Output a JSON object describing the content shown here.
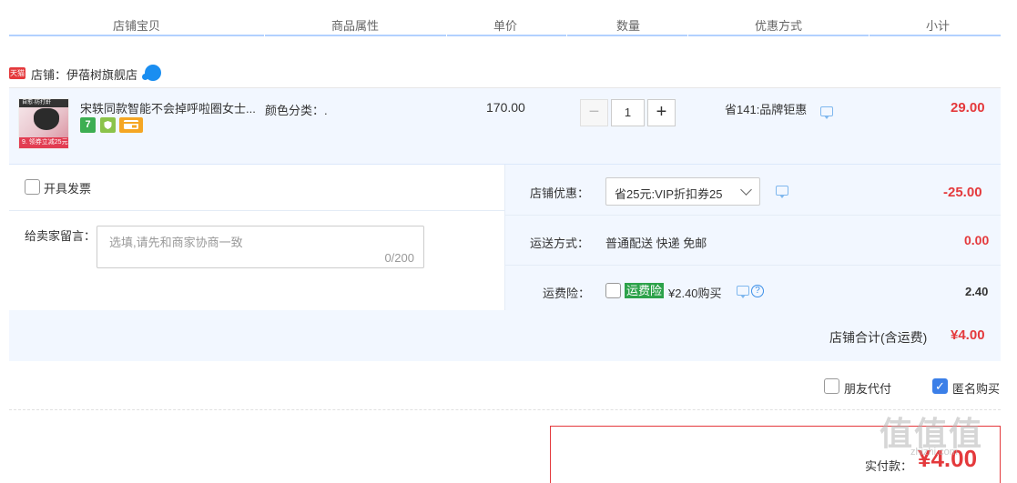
{
  "header": {
    "col_item": "店铺宝贝",
    "col_attr": "商品属性",
    "col_price": "单价",
    "col_qty": "数量",
    "col_promo": "优惠方式",
    "col_subtotal": "小计"
  },
  "shop": {
    "badge": "天猫",
    "label": "店铺：伊蓓树旗舰店"
  },
  "item": {
    "thumb_top": "自愈·防打鼾",
    "thumb_tag": "9. 领券立减25元",
    "title": "宋轶同款智能不会掉呼啦圈女士...",
    "services": [
      "7",
      "",
      ""
    ],
    "sku": "颜色分类：.",
    "price": "170.00",
    "quantity": "1",
    "minus": "−",
    "plus": "+",
    "promo": "省141:品牌钜惠",
    "subtotal": "29.00"
  },
  "options": {
    "invoice_label": "开具发票",
    "message_label": "给卖家留言：",
    "message_placeholder": "选填,请先和商家协商一致",
    "message_counter": "0/200",
    "store_discount_label": "店铺优惠：",
    "store_discount_value": "省25元:VIP折扣券25",
    "store_discount_amount": "-25.00",
    "shipping_label": "运送方式：",
    "shipping_value": "普通配送 快递 免邮",
    "shipping_amount": "0.00",
    "insurance_label": "运费险：",
    "insurance_badge": "运费险",
    "insurance_text": "¥2.40购买",
    "insurance_amount": "2.40",
    "store_total_label": "店铺合计(含运费)",
    "store_total_value": "¥4.00"
  },
  "footer": {
    "friend_pay_label": "朋友代付",
    "anonymous_label": "匿名购买",
    "anonymous_checked": true,
    "pay_label": "实付款：",
    "pay_value": "¥4.00"
  },
  "watermark": {
    "big": "值值值",
    "small": "zhizhi.com"
  },
  "colors": {
    "accent_red": "#e4393c",
    "row_bg": "#f2f7ff",
    "header_line": "#b2d1ff",
    "checkbox_blue": "#3b7fe8"
  }
}
